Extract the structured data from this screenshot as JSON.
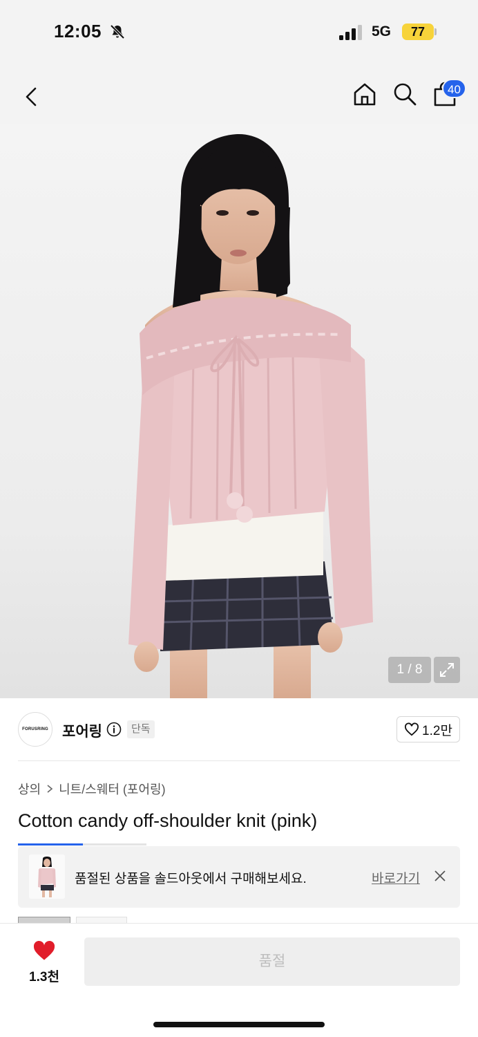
{
  "status_bar": {
    "time": "12:05",
    "network": "5G",
    "battery": "77"
  },
  "header": {
    "cart_count": "40",
    "icons": [
      "back-icon",
      "home-icon",
      "search-icon",
      "shopping-bag-icon"
    ]
  },
  "gallery": {
    "counter": "1 / 8"
  },
  "brand": {
    "logo_text": "FORUSRING",
    "name": "포어링",
    "tag": "단독",
    "like_count": "1.2만"
  },
  "breadcrumb": {
    "category": "상의",
    "subcategory": "니트/스웨터 (포어링)"
  },
  "product": {
    "title": "Cotton candy off-shoulder knit (pink)"
  },
  "banner": {
    "text": "품절된 상품을 솔드아웃에서 구매해보세요.",
    "link_label": "바로가기"
  },
  "bottom_bar": {
    "wish_count": "1.3천",
    "action_label": "품절"
  },
  "colors": {
    "accent": "#2563eb",
    "battery": "#f7d33a",
    "heart": "#e11d2a"
  }
}
